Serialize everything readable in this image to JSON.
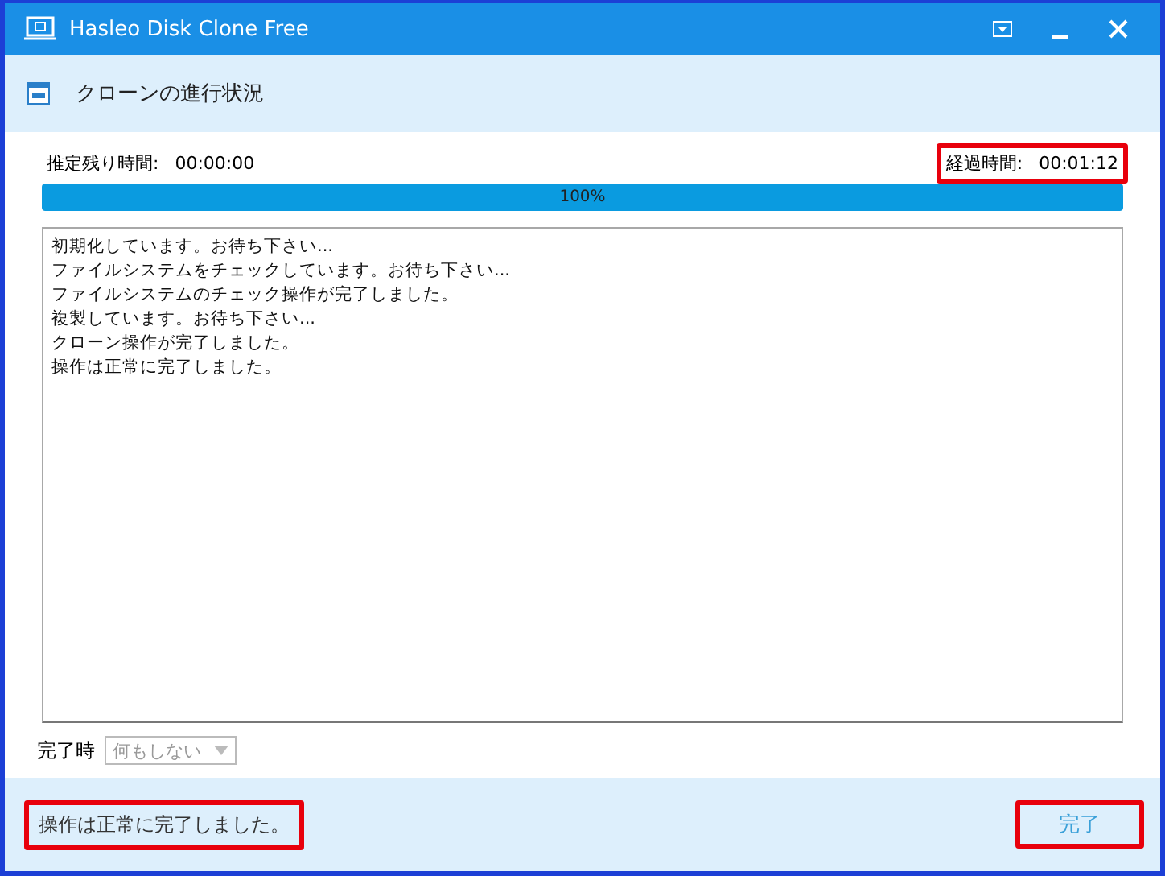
{
  "window": {
    "title": "Hasleo Disk Clone Free"
  },
  "header": {
    "title": "クローンの進行状況"
  },
  "remaining": {
    "label": "推定残り時間:",
    "value": "00:00:00"
  },
  "elapsed": {
    "label": "経過時間:",
    "value": "00:01:12",
    "highlighted": true
  },
  "progress": {
    "level": 1,
    "label": "100%"
  },
  "log": [
    "初期化しています。お待ち下さい...",
    "ファイルシステムをチェックしています。お待ち下さい...",
    "ファイルシステムのチェック操作が完了しました。",
    "複製しています。お待ち下さい...",
    "クローン操作が完了しました。",
    "操作は正常に完了しました。"
  ],
  "on_complete": {
    "label": "完了時",
    "value": "何もしない",
    "disabled": true
  },
  "status_bar": {
    "message": "操作は正常に完了しました。",
    "highlighted": true
  },
  "buttons": [
    {
      "label": "完了",
      "highlighted": true
    }
  ]
}
